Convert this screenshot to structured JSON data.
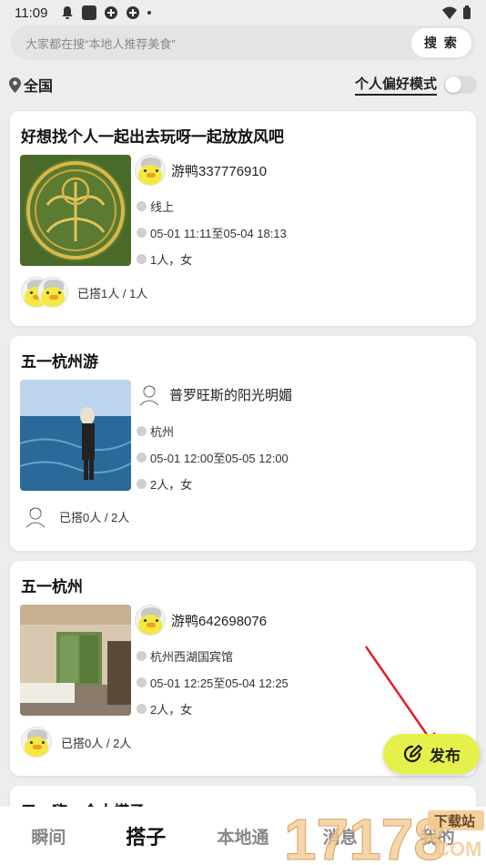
{
  "status_bar": {
    "time": "11:09"
  },
  "search": {
    "placeholder": "大家都在搜“本地人推荐美食”",
    "button_label": "搜 索"
  },
  "location": {
    "label": "全国"
  },
  "preference": {
    "label": "个人偏好模式",
    "enabled": false
  },
  "cards": [
    {
      "title": "好想找个人一起出去玩呀一起放放风吧",
      "author": "游鸭337776910",
      "place": "线上",
      "time": "05-01 11:11至05-04 18:13",
      "people": "1人，女",
      "joined": "已搭1人 / 1人"
    },
    {
      "title": "五一杭州游",
      "author": "普罗旺斯的阳光明媚",
      "place": "杭州",
      "time": "05-01 12:00至05-05 12:00",
      "people": "2人，女",
      "joined": "已搭0人 / 2人"
    },
    {
      "title": "五一杭州",
      "author": "游鸭642698076",
      "place": "杭州西湖国宾馆",
      "time": "05-01 12:25至05-04 12:25",
      "people": "2人，女",
      "joined": "已搭0人 / 2人"
    },
    {
      "title": "五一嗨，个人搭子"
    }
  ],
  "fab": {
    "label": "发布"
  },
  "tabs": [
    {
      "label": "瞬间",
      "active": false
    },
    {
      "label": "搭子",
      "active": true
    },
    {
      "label": "本地通",
      "active": false
    },
    {
      "label": "消息",
      "active": false
    },
    {
      "label": "我的",
      "active": false
    }
  ],
  "watermark": {
    "number": "17178",
    "site": "下载站",
    "domain": ".COM"
  },
  "colors": {
    "accent": "#e6f04a",
    "background": "#ededed",
    "card": "#ffffff",
    "arrow": "#e02020"
  }
}
